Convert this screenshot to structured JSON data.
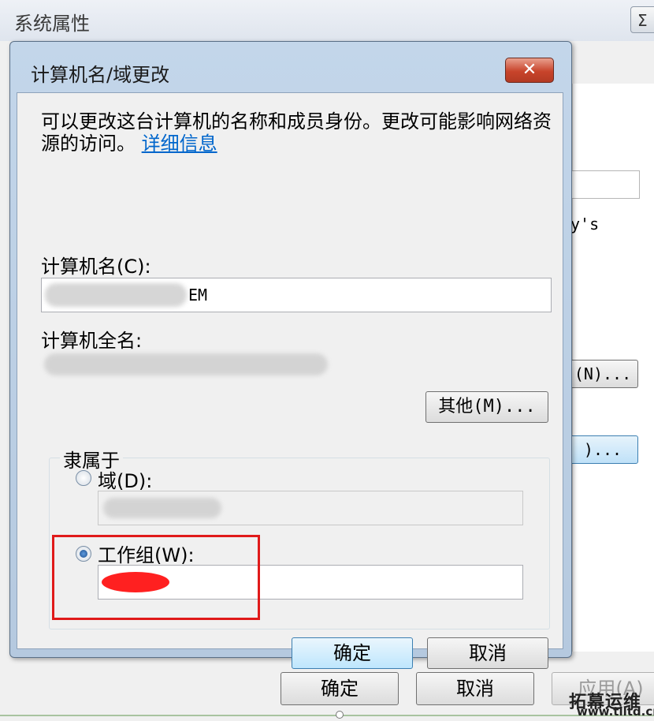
{
  "background_window": {
    "title": "系统属性",
    "close_glyph": "Σ",
    "text_fragment": "y's",
    "button_n_label": "(N)...",
    "button_c_label": ")...",
    "buttons": {
      "ok": "确定",
      "cancel": "取消",
      "apply": "应用(A)"
    }
  },
  "dialog": {
    "title": "计算机名/域更改",
    "close_glyph": "✕",
    "description": "可以更改这台计算机的名称和成员身份。更改可能影响网络资源的访问。",
    "details_link": "详细信息",
    "computer_name_label": "计算机名(C):",
    "computer_name_value_visible": "EM",
    "full_name_label": "计算机全名:",
    "other_button": "其他(M)...",
    "member_of": {
      "legend": "隶属于",
      "domain_label": "域(D):",
      "workgroup_label": "工作组(W):",
      "selected": "workgroup"
    },
    "ok_button": "确定",
    "cancel_button": "取消"
  },
  "watermark": {
    "brand": "拓幕运维",
    "url": "www.tlltd.cn"
  }
}
